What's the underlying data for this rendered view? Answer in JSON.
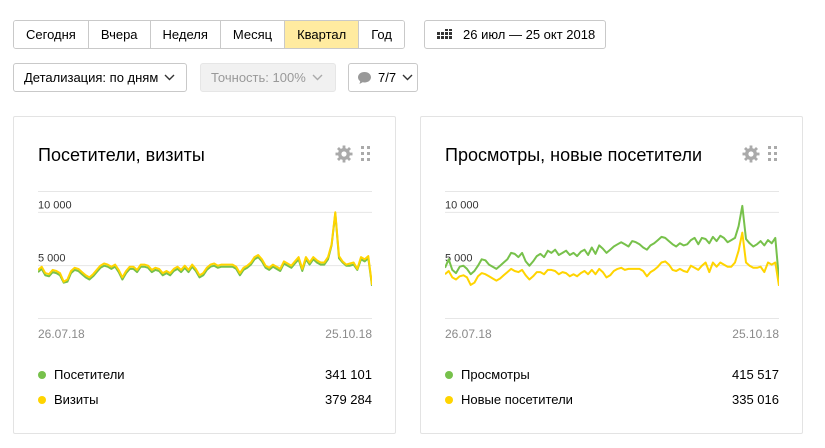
{
  "periods": [
    {
      "label": "Сегодня",
      "active": false
    },
    {
      "label": "Вчера",
      "active": false
    },
    {
      "label": "Неделя",
      "active": false
    },
    {
      "label": "Месяц",
      "active": false
    },
    {
      "label": "Квартал",
      "active": true
    },
    {
      "label": "Год",
      "active": false
    }
  ],
  "date_range": "26 июл — 25 окт 2018",
  "filters": {
    "detail": "Детализация: по дням",
    "accuracy": "Точность: 100%",
    "segments": "7/7"
  },
  "colors": {
    "green": "#77c14b",
    "yellow": "#ffd400",
    "active_period": "#ffeba0",
    "grid": "#e6e6e6"
  },
  "widgets": [
    {
      "title": "Посетители, визиты",
      "x_start": "26.07.18",
      "x_end": "25.10.18",
      "legend": [
        {
          "name": "Посетители",
          "value": "341 101",
          "color": "#77c14b"
        },
        {
          "name": "Визиты",
          "value": "379 284",
          "color": "#ffd400"
        }
      ]
    },
    {
      "title": "Просмотры, новые посетители",
      "x_start": "26.07.18",
      "x_end": "25.10.18",
      "legend": [
        {
          "name": "Просмотры",
          "value": "415 517",
          "color": "#77c14b"
        },
        {
          "name": "Новые посетители",
          "value": "335 016",
          "color": "#ffd400"
        }
      ]
    }
  ],
  "chart_data": [
    {
      "type": "line",
      "title": "Посетители, визиты",
      "x_range": [
        "26.07.18",
        "25.10.18"
      ],
      "y_ticks": [
        "5 000",
        "10 000"
      ],
      "ylim": [
        0,
        12000
      ],
      "series": [
        {
          "name": "Посетители",
          "color": "#77c14b",
          "values": [
            4400,
            4700,
            4100,
            4000,
            4400,
            4300,
            4100,
            3400,
            3500,
            4300,
            4600,
            4500,
            4200,
            3900,
            3700,
            4000,
            4400,
            4800,
            5000,
            4900,
            4700,
            4900,
            4400,
            3700,
            4300,
            4700,
            4700,
            4400,
            4900,
            4900,
            4800,
            4400,
            4600,
            4500,
            4100,
            4300,
            4100,
            4500,
            4700,
            4400,
            4800,
            4400,
            4900,
            4500,
            3900,
            4100,
            4600,
            4900,
            5000,
            4800,
            4900,
            4900,
            4900,
            4900,
            4700,
            4100,
            4600,
            4800,
            5100,
            5600,
            5800,
            5400,
            4800,
            4600,
            4900,
            4700,
            4500,
            5200,
            5000,
            4800,
            5200,
            5600,
            4500,
            5600,
            5100,
            5600,
            5300,
            5100,
            5100,
            5600,
            6900,
            9900,
            5700,
            5300,
            5000,
            5000,
            5100,
            4600,
            5600,
            5400,
            5700,
            3100
          ]
        },
        {
          "name": "Визиты",
          "color": "#ffd400",
          "values": [
            4600,
            4900,
            4300,
            4200,
            4600,
            4500,
            4300,
            3500,
            3700,
            4500,
            4800,
            4700,
            4400,
            4100,
            3900,
            4200,
            4600,
            5000,
            5200,
            5100,
            4900,
            5100,
            4600,
            3900,
            4500,
            4900,
            4900,
            4600,
            5100,
            5100,
            5000,
            4600,
            4800,
            4700,
            4300,
            4500,
            4300,
            4700,
            4900,
            4600,
            5000,
            4600,
            5100,
            4700,
            4100,
            4300,
            4800,
            5100,
            5200,
            5000,
            5100,
            5100,
            5100,
            5100,
            4900,
            4300,
            4800,
            5000,
            5300,
            5800,
            6000,
            5600,
            5000,
            4800,
            5100,
            4900,
            4700,
            5400,
            5200,
            5000,
            5400,
            5800,
            4700,
            5800,
            5300,
            5800,
            5500,
            5300,
            5300,
            5800,
            7000,
            10000,
            5900,
            5400,
            5100,
            5200,
            5300,
            4700,
            5800,
            5600,
            5900,
            3200
          ]
        }
      ]
    },
    {
      "type": "line",
      "title": "Просмотры, новые посетители",
      "x_range": [
        "26.07.18",
        "25.10.18"
      ],
      "y_ticks": [
        "5 000",
        "10 000"
      ],
      "ylim": [
        0,
        12000
      ],
      "series": [
        {
          "name": "Просмотры",
          "color": "#77c14b",
          "values": [
            4800,
            5600,
            4600,
            4300,
            4900,
            5000,
            4700,
            4200,
            4500,
            5000,
            5600,
            5500,
            5100,
            4900,
            4700,
            5000,
            5300,
            5600,
            6200,
            6100,
            5800,
            6200,
            5400,
            5000,
            5400,
            5900,
            6100,
            5800,
            6400,
            6200,
            6500,
            6000,
            6200,
            6400,
            6000,
            6200,
            5900,
            6300,
            6500,
            6000,
            6700,
            6100,
            6900,
            6600,
            6200,
            6500,
            6800,
            7000,
            7200,
            7000,
            6800,
            7300,
            7200,
            7000,
            6700,
            6500,
            6900,
            7100,
            7400,
            7700,
            7600,
            7300,
            7000,
            6800,
            7100,
            6900,
            7000,
            7400,
            7600,
            7000,
            7600,
            7500,
            7100,
            7700,
            7300,
            7800,
            7600,
            7200,
            7400,
            7600,
            8700,
            10600,
            7500,
            7100,
            6800,
            7000,
            7300,
            6900,
            7400,
            7100,
            7600,
            3700
          ]
        },
        {
          "name": "Новые посетители",
          "color": "#ffd400",
          "values": [
            4200,
            4500,
            3900,
            3700,
            4000,
            4100,
            3900,
            3200,
            3400,
            4000,
            4300,
            4200,
            4000,
            3800,
            3600,
            3800,
            4100,
            4400,
            4700,
            4500,
            4400,
            4600,
            4100,
            3700,
            4000,
            4400,
            4400,
            4200,
            4600,
            4600,
            4500,
            4200,
            4400,
            4300,
            4000,
            4200,
            4000,
            4300,
            4500,
            4200,
            4600,
            4200,
            4700,
            4400,
            3900,
            4100,
            4500,
            4700,
            4800,
            4600,
            4700,
            4700,
            4700,
            4700,
            4500,
            4000,
            4400,
            4600,
            4900,
            5300,
            5400,
            5100,
            4600,
            4500,
            4700,
            4500,
            4400,
            5000,
            4800,
            4600,
            5000,
            5300,
            4400,
            5300,
            4900,
            5300,
            5100,
            4900,
            4900,
            5300,
            6400,
            8100,
            5300,
            5000,
            4800,
            4800,
            4900,
            4400,
            5300,
            5100,
            5300,
            3100
          ]
        }
      ]
    }
  ]
}
